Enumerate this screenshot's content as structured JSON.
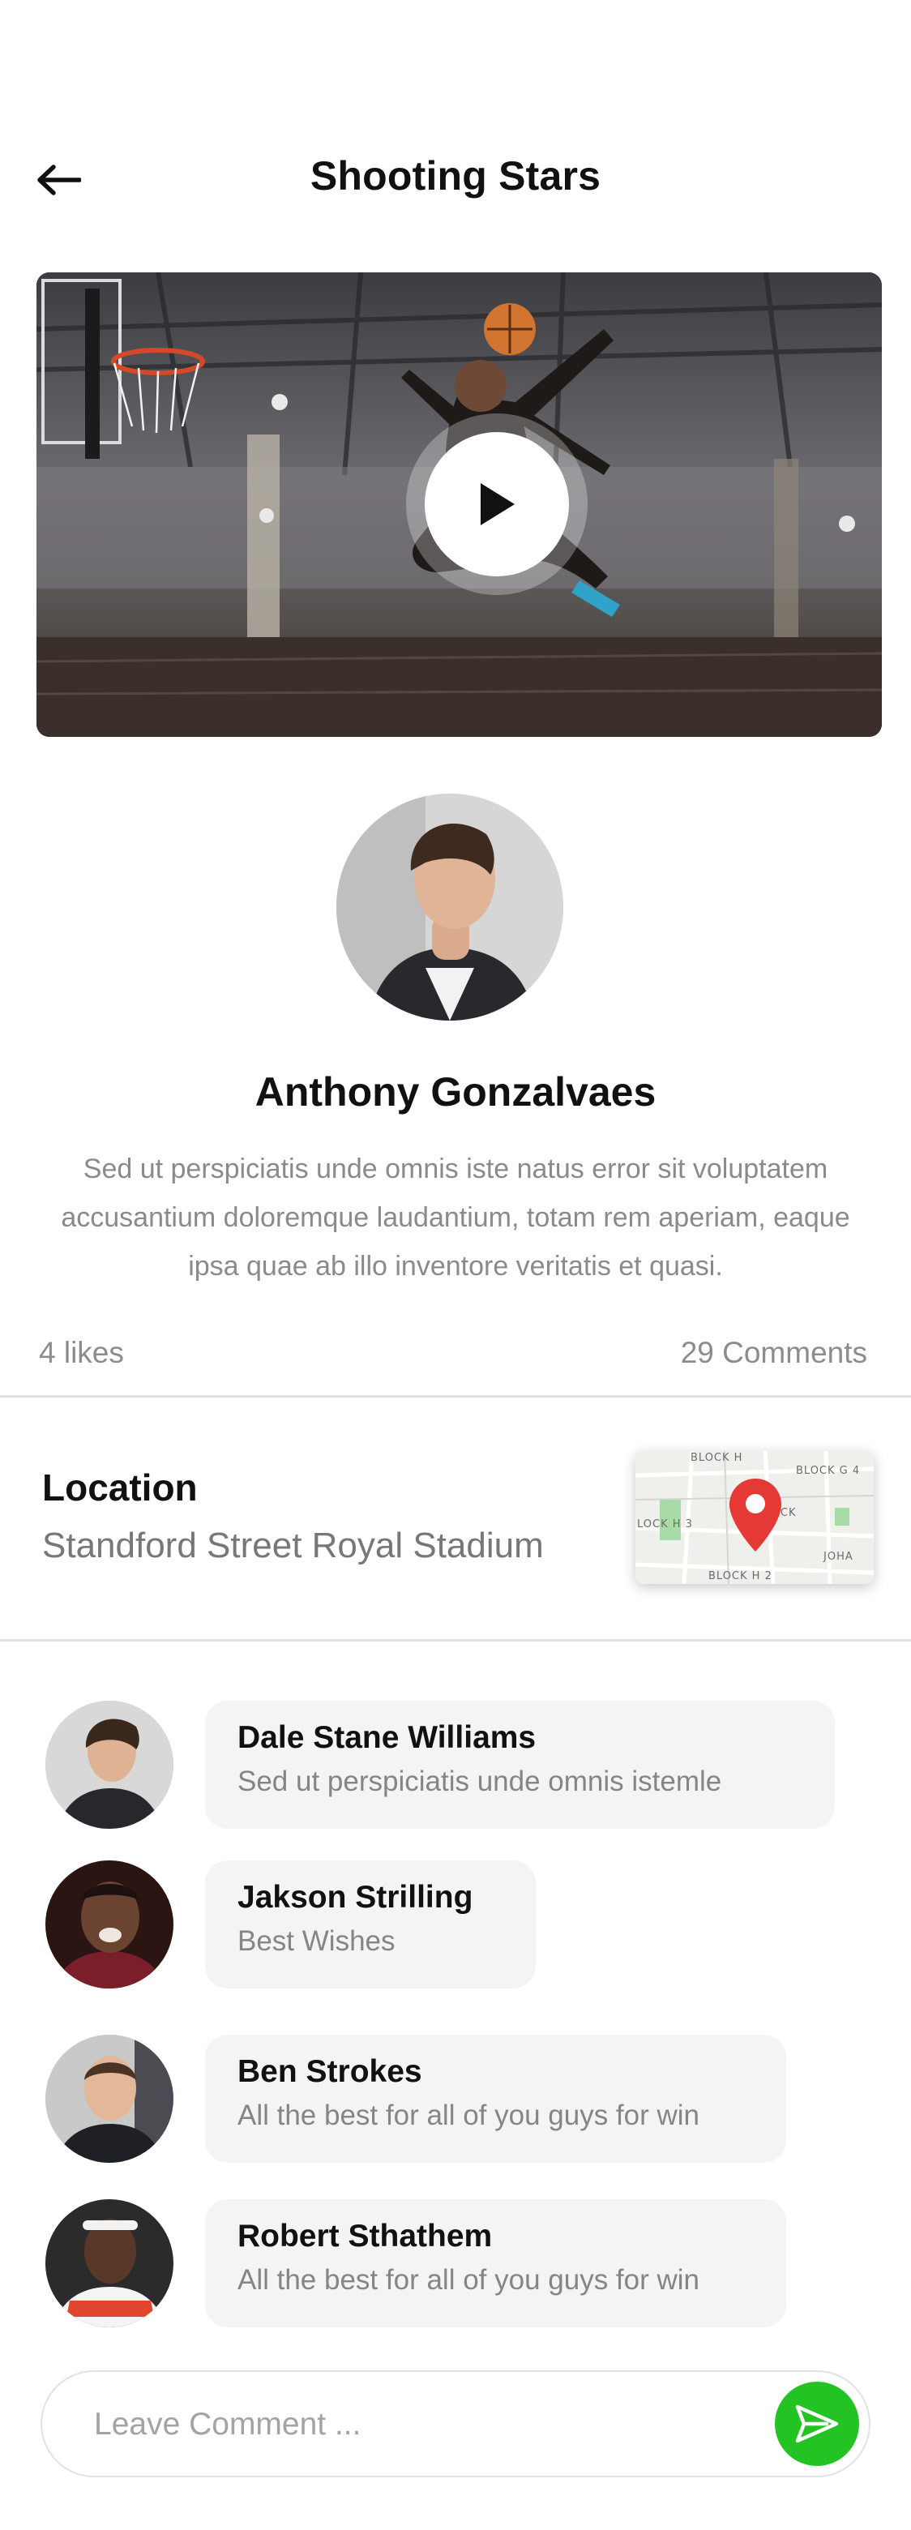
{
  "header": {
    "title": "Shooting Stars",
    "back_icon": "arrow-left-icon"
  },
  "video": {
    "play_icon": "play-icon"
  },
  "author": {
    "name": "Anthony Gonzalvaes",
    "bio": "Sed ut perspiciatis unde omnis iste natus error sit voluptatem accusantium doloremque laudantium, totam rem aperiam, eaque ipsa quae ab illo inventore veritatis et quasi."
  },
  "stats": {
    "likes": "4 likes",
    "comments": "29 Comments"
  },
  "location": {
    "label": "Location",
    "value": "Standford Street Royal Stadium",
    "map": {
      "labels": [
        "BLOCK H",
        "BLOCK G 4",
        "LOCK H 3",
        "BLOCK",
        "BLOCK H 2",
        "JOHA"
      ],
      "pin_icon": "map-pin-icon"
    }
  },
  "comments": [
    {
      "name": "Dale Stane Williams",
      "text": "Sed ut perspiciatis unde omnis istemle"
    },
    {
      "name": "Jakson Strilling",
      "text": "Best Wishes"
    },
    {
      "name": "Ben Strokes",
      "text": "All the best for all of you guys for win"
    },
    {
      "name": "Robert Sthathem",
      "text": "All the best for all of you guys for win"
    }
  ],
  "comment_input": {
    "placeholder": "Leave Comment ...",
    "send_icon": "send-icon"
  },
  "colors": {
    "accent_green": "#22c322",
    "pin_red": "#e53935",
    "bubble_bg": "#f4f4f4",
    "muted_text": "#858585"
  }
}
